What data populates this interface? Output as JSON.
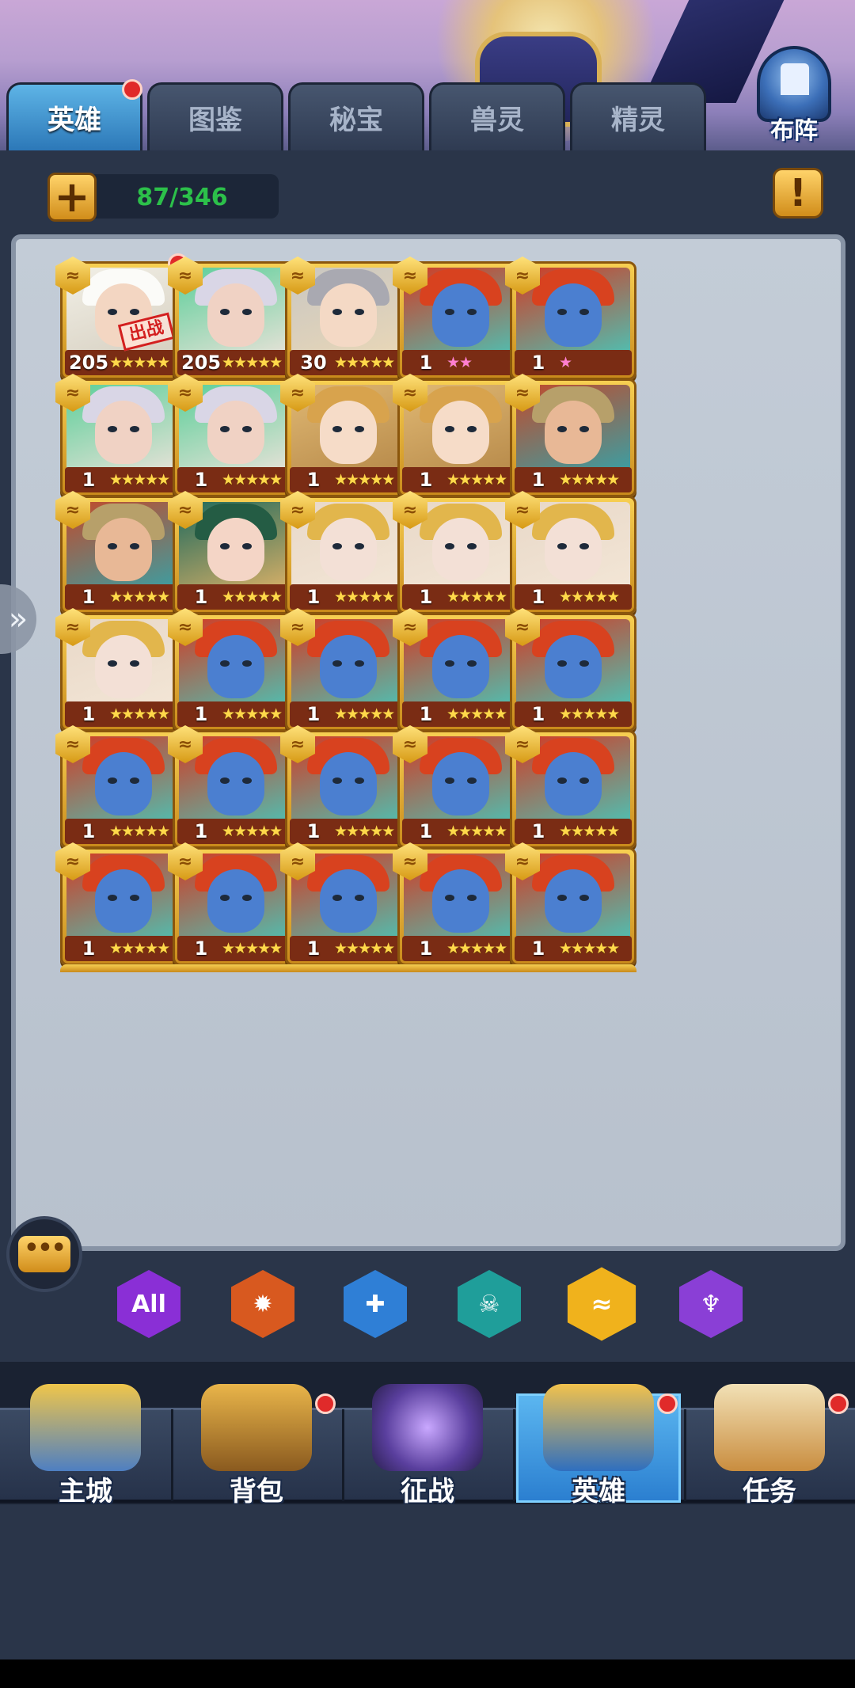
{
  "tabs": [
    {
      "label": "英雄",
      "active": true,
      "has_notification": true
    },
    {
      "label": "图鉴",
      "active": false,
      "has_notification": false
    },
    {
      "label": "秘宝",
      "active": false,
      "has_notification": false
    },
    {
      "label": "兽灵",
      "active": false,
      "has_notification": false
    },
    {
      "label": "精灵",
      "active": false,
      "has_notification": false
    }
  ],
  "formation_button": {
    "label": "布阵",
    "icon": "castle-tower-icon"
  },
  "hero_count": {
    "text": "87/346",
    "color": "#2cc04a"
  },
  "add_button_icon": "plus-icon",
  "info_button_icon": "exclamation-icon",
  "side_handle_icon": "double-chevron-right-icon",
  "chat_button": {
    "icon": "chat-bubble-icon",
    "glyph": "•••"
  },
  "hero_cards": [
    {
      "level": "205",
      "stars": "★★★★★",
      "star_color": "gold",
      "portrait": "white-hair-hero",
      "deployed": true,
      "deployed_label": "出战",
      "has_notification": true
    },
    {
      "level": "205",
      "stars": "★★★★★",
      "star_color": "gold",
      "portrait": "silver-hair-elf-hero",
      "deployed": false,
      "has_notification": false
    },
    {
      "level": "30",
      "stars": "★★★★★",
      "star_color": "gold",
      "portrait": "helmeted-girl-hero",
      "deployed": false,
      "has_notification": false
    },
    {
      "level": "1",
      "stars": "★★",
      "star_color": "pink",
      "portrait": "blue-troll-hero",
      "deployed": false,
      "has_notification": false
    },
    {
      "level": "1",
      "stars": "★",
      "star_color": "pink",
      "portrait": "blue-troll-hero",
      "deployed": false,
      "has_notification": false
    },
    {
      "level": "1",
      "stars": "★★★★★",
      "star_color": "gold",
      "portrait": "silver-hair-elf-hero",
      "deployed": false,
      "has_notification": false
    },
    {
      "level": "1",
      "stars": "★★★★★",
      "star_color": "gold",
      "portrait": "silver-hair-elf-hero",
      "deployed": false,
      "has_notification": false
    },
    {
      "level": "1",
      "stars": "★★★★★",
      "star_color": "gold",
      "portrait": "blonde-girl-hero",
      "deployed": false,
      "has_notification": false
    },
    {
      "level": "1",
      "stars": "★★★★★",
      "star_color": "gold",
      "portrait": "blonde-girl-hero",
      "deployed": false,
      "has_notification": false
    },
    {
      "level": "1",
      "stars": "★★★★★",
      "star_color": "gold",
      "portrait": "tattooed-elf-hero",
      "deployed": false,
      "has_notification": false
    },
    {
      "level": "1",
      "stars": "★★★★★",
      "star_color": "gold",
      "portrait": "tattooed-elf-hero",
      "deployed": false,
      "has_notification": false
    },
    {
      "level": "1",
      "stars": "★★★★★",
      "star_color": "gold",
      "portrait": "green-hair-girl-hero",
      "deployed": false,
      "has_notification": false
    },
    {
      "level": "1",
      "stars": "★★★★★",
      "star_color": "gold",
      "portrait": "golden-helm-hero",
      "deployed": false,
      "has_notification": false
    },
    {
      "level": "1",
      "stars": "★★★★★",
      "star_color": "gold",
      "portrait": "golden-helm-hero",
      "deployed": false,
      "has_notification": false
    },
    {
      "level": "1",
      "stars": "★★★★★",
      "star_color": "gold",
      "portrait": "golden-helm-hero",
      "deployed": false,
      "has_notification": false
    },
    {
      "level": "1",
      "stars": "★★★★★",
      "star_color": "gold",
      "portrait": "golden-helm-hero",
      "deployed": false,
      "has_notification": false
    },
    {
      "level": "1",
      "stars": "★★★★★",
      "star_color": "gold",
      "portrait": "blue-troll-hero",
      "deployed": false,
      "has_notification": false
    },
    {
      "level": "1",
      "stars": "★★★★★",
      "star_color": "gold",
      "portrait": "blue-troll-hero",
      "deployed": false,
      "has_notification": false
    },
    {
      "level": "1",
      "stars": "★★★★★",
      "star_color": "gold",
      "portrait": "blue-troll-hero",
      "deployed": false,
      "has_notification": false
    },
    {
      "level": "1",
      "stars": "★★★★★",
      "star_color": "gold",
      "portrait": "blue-troll-hero",
      "deployed": false,
      "has_notification": false
    },
    {
      "level": "1",
      "stars": "★★★★★",
      "star_color": "gold",
      "portrait": "blue-troll-hero",
      "deployed": false,
      "has_notification": false
    },
    {
      "level": "1",
      "stars": "★★★★★",
      "star_color": "gold",
      "portrait": "blue-troll-hero",
      "deployed": false,
      "has_notification": false
    },
    {
      "level": "1",
      "stars": "★★★★★",
      "star_color": "gold",
      "portrait": "blue-troll-hero",
      "deployed": false,
      "has_notification": false
    },
    {
      "level": "1",
      "stars": "★★★★★",
      "star_color": "gold",
      "portrait": "blue-troll-hero",
      "deployed": false,
      "has_notification": false
    },
    {
      "level": "1",
      "stars": "★★★★★",
      "star_color": "gold",
      "portrait": "blue-troll-hero",
      "deployed": false,
      "has_notification": false
    },
    {
      "level": "1",
      "stars": "★★★★★",
      "star_color": "gold",
      "portrait": "blue-troll-hero",
      "deployed": false,
      "has_notification": false
    },
    {
      "level": "1",
      "stars": "★★★★★",
      "star_color": "gold",
      "portrait": "blue-troll-hero",
      "deployed": false,
      "has_notification": false
    },
    {
      "level": "1",
      "stars": "★★★★★",
      "star_color": "gold",
      "portrait": "blue-troll-hero",
      "deployed": false,
      "has_notification": false
    },
    {
      "level": "1",
      "stars": "★★★★★",
      "star_color": "gold",
      "portrait": "blue-troll-hero",
      "deployed": false,
      "has_notification": false
    },
    {
      "level": "1",
      "stars": "★★★★★",
      "star_color": "gold",
      "portrait": "blue-troll-hero",
      "deployed": false,
      "has_notification": false
    }
  ],
  "filters": [
    {
      "label": "All",
      "icon": "all-factions-icon",
      "color": "#8a2fd6",
      "active": false
    },
    {
      "label": "",
      "icon": "fire-faction-icon",
      "color": "#d8591f",
      "active": false
    },
    {
      "label": "",
      "icon": "cross-faction-icon",
      "color": "#2f7fd6",
      "active": false
    },
    {
      "label": "",
      "icon": "skull-faction-icon",
      "color": "#1f9e9a",
      "active": false
    },
    {
      "label": "",
      "icon": "feather-faction-icon",
      "color": "#f0b21c",
      "active": true
    },
    {
      "label": "",
      "icon": "trident-faction-icon",
      "color": "#8a3fd6",
      "active": false
    }
  ],
  "bottom_nav": [
    {
      "label": "主城",
      "icon": "castle-icon",
      "active": false,
      "has_notification": false
    },
    {
      "label": "背包",
      "icon": "treasure-chest-icon",
      "active": false,
      "has_notification": true
    },
    {
      "label": "征战",
      "icon": "dragon-portal-icon",
      "active": false,
      "has_notification": false
    },
    {
      "label": "英雄",
      "icon": "hero-helmet-icon",
      "active": true,
      "has_notification": true
    },
    {
      "label": "任务",
      "icon": "scroll-icon",
      "active": false,
      "has_notification": true
    }
  ]
}
